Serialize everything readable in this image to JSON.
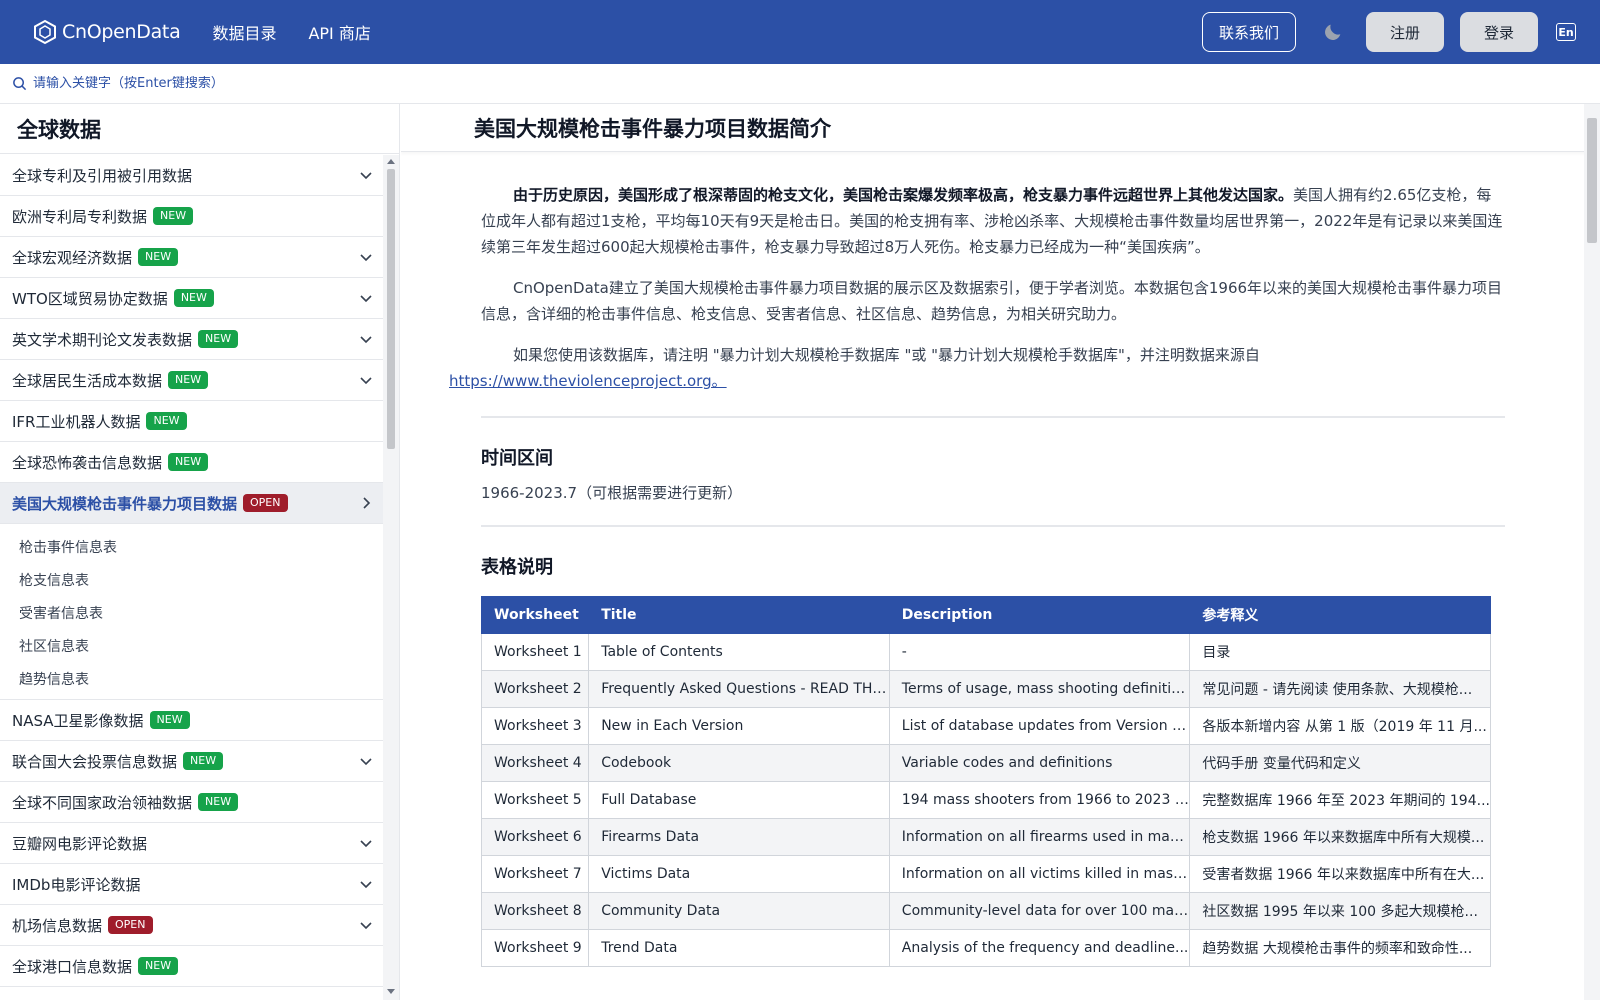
{
  "header": {
    "logo_text": "CnOpenData",
    "nav": [
      "数据目录",
      "API 商店"
    ],
    "contact_label": "联系我们",
    "register_label": "注册",
    "login_label": "登录",
    "lang_label": "En"
  },
  "search": {
    "placeholder": "请输入关键字（按Enter键搜索）"
  },
  "sidebar": {
    "title": "全球数据",
    "items": [
      {
        "label": "全球专利及引用被引用数据",
        "badge": "",
        "chevron": "down"
      },
      {
        "label": "欧洲专利局专利数据",
        "badge": "NEW",
        "chevron": ""
      },
      {
        "label": "全球宏观经济数据",
        "badge": "NEW",
        "chevron": "down"
      },
      {
        "label": "WTO区域贸易协定数据",
        "badge": "NEW",
        "chevron": "down"
      },
      {
        "label": "英文学术期刊论文发表数据",
        "badge": "NEW",
        "chevron": "down"
      },
      {
        "label": "全球居民生活成本数据",
        "badge": "NEW",
        "chevron": "down"
      },
      {
        "label": "IFR工业机器人数据",
        "badge": "NEW",
        "chevron": ""
      },
      {
        "label": "全球恐怖袭击信息数据",
        "badge": "NEW",
        "chevron": ""
      },
      {
        "label": "美国大规模枪击事件暴力项目数据",
        "badge": "OPEN",
        "chevron": "right"
      }
    ],
    "subitems": [
      "枪击事件信息表",
      "枪支信息表",
      "受害者信息表",
      "社区信息表",
      "趋势信息表"
    ],
    "items_after": [
      {
        "label": "NASA卫星影像数据",
        "badge": "NEW",
        "chevron": ""
      },
      {
        "label": "联合国大会投票信息数据",
        "badge": "NEW",
        "chevron": "down"
      },
      {
        "label": "全球不同国家政治领袖数据",
        "badge": "NEW",
        "chevron": ""
      },
      {
        "label": "豆瓣网电影评论数据",
        "badge": "",
        "chevron": "down"
      },
      {
        "label": "IMDb电影评论数据",
        "badge": "",
        "chevron": "down"
      },
      {
        "label": "机场信息数据",
        "badge": "OPEN",
        "chevron": "down"
      },
      {
        "label": "全球港口信息数据",
        "badge": "NEW",
        "chevron": ""
      }
    ]
  },
  "content": {
    "title": "美国大规模枪击事件暴力项目数据简介",
    "intro_bold": "由于历史原因，美国形成了根深蒂固的枪支文化，美国枪击案爆发频率极高，枪支暴力事件远超世界上其他发达国家。",
    "intro_rest": "美国人拥有约2.65亿支枪，每位成年人都有超过1支枪，平均每10天有9天是枪击日。美国的枪支拥有率、涉枪凶杀率、大规模枪击事件数量均居世界第一，2022年是有记录以来美国连续第三年发生超过600起大规模枪击事件，枪支暴力导致超过8万人死伤。枪支暴力已经成为一种“美国疾病”。",
    "para2": "CnOpenData建立了美国大规模枪击事件暴力项目数据的展示区及数据索引，便于学者浏览。本数据包含1966年以来的美国大规模枪击事件暴力项目信息，含详细的枪击事件信息、枪支信息、受害者信息、社区信息、趋势信息，为相关研究助力。",
    "para3": "如果您使用该数据库，请注明 \"暴力计划大规模枪手数据库 \"或 \"暴力计划大规模枪手数据库\"，并注明数据来源自",
    "link": "https://www.theviolenceproject.org。",
    "period_title": "时间区间",
    "period_text": "1966-2023.7（可根据需要进行更新）",
    "table_title": "表格说明",
    "table_headers": [
      "Worksheet",
      "Title",
      "Description",
      "参考释义"
    ],
    "table_rows": [
      [
        "Worksheet 1",
        "Table of Contents",
        "-",
        "目录"
      ],
      [
        "Worksheet 2",
        "Frequently Asked Questions - READ THI...",
        "Terms of usage, mass shooting definitio...",
        "常见问题 - 请先阅读 使用条款、大规模枪..."
      ],
      [
        "Worksheet 3",
        "New in Each Version",
        "List of database updates from Version 1 ...",
        "各版本新增内容 从第 1 版（2019 年 11 月..."
      ],
      [
        "Worksheet 4",
        "Codebook",
        "Variable codes and definitions",
        "代码手册 变量代码和定义"
      ],
      [
        "Worksheet 5",
        "Full Database",
        "194 mass shooters from 1966 to 2023 c...",
        "完整数据库 1966 年至 2023 年期间的 194..."
      ],
      [
        "Worksheet 6",
        "Firearms Data",
        "Information on all firearms used in mass ...",
        "枪支数据 1966 年以来数据库中所有大规模..."
      ],
      [
        "Worksheet 7",
        "Victims Data",
        "Information on all victims killed in mass s...",
        "受害者数据 1966 年以来数据库中所有在大..."
      ],
      [
        "Worksheet 8",
        "Community Data",
        "Community-level data for over 100 mass...",
        "社区数据 1995 年以来 100 多起大规模枪..."
      ],
      [
        "Worksheet 9",
        "Trend Data",
        "Analysis of the frequency and deadline...",
        "趋势数据 大规模枪击事件的频率和致命性..."
      ]
    ]
  },
  "colors": {
    "brand": "#2c50a6",
    "new_badge": "#16a34a",
    "open_badge": "#9f1d2b"
  }
}
